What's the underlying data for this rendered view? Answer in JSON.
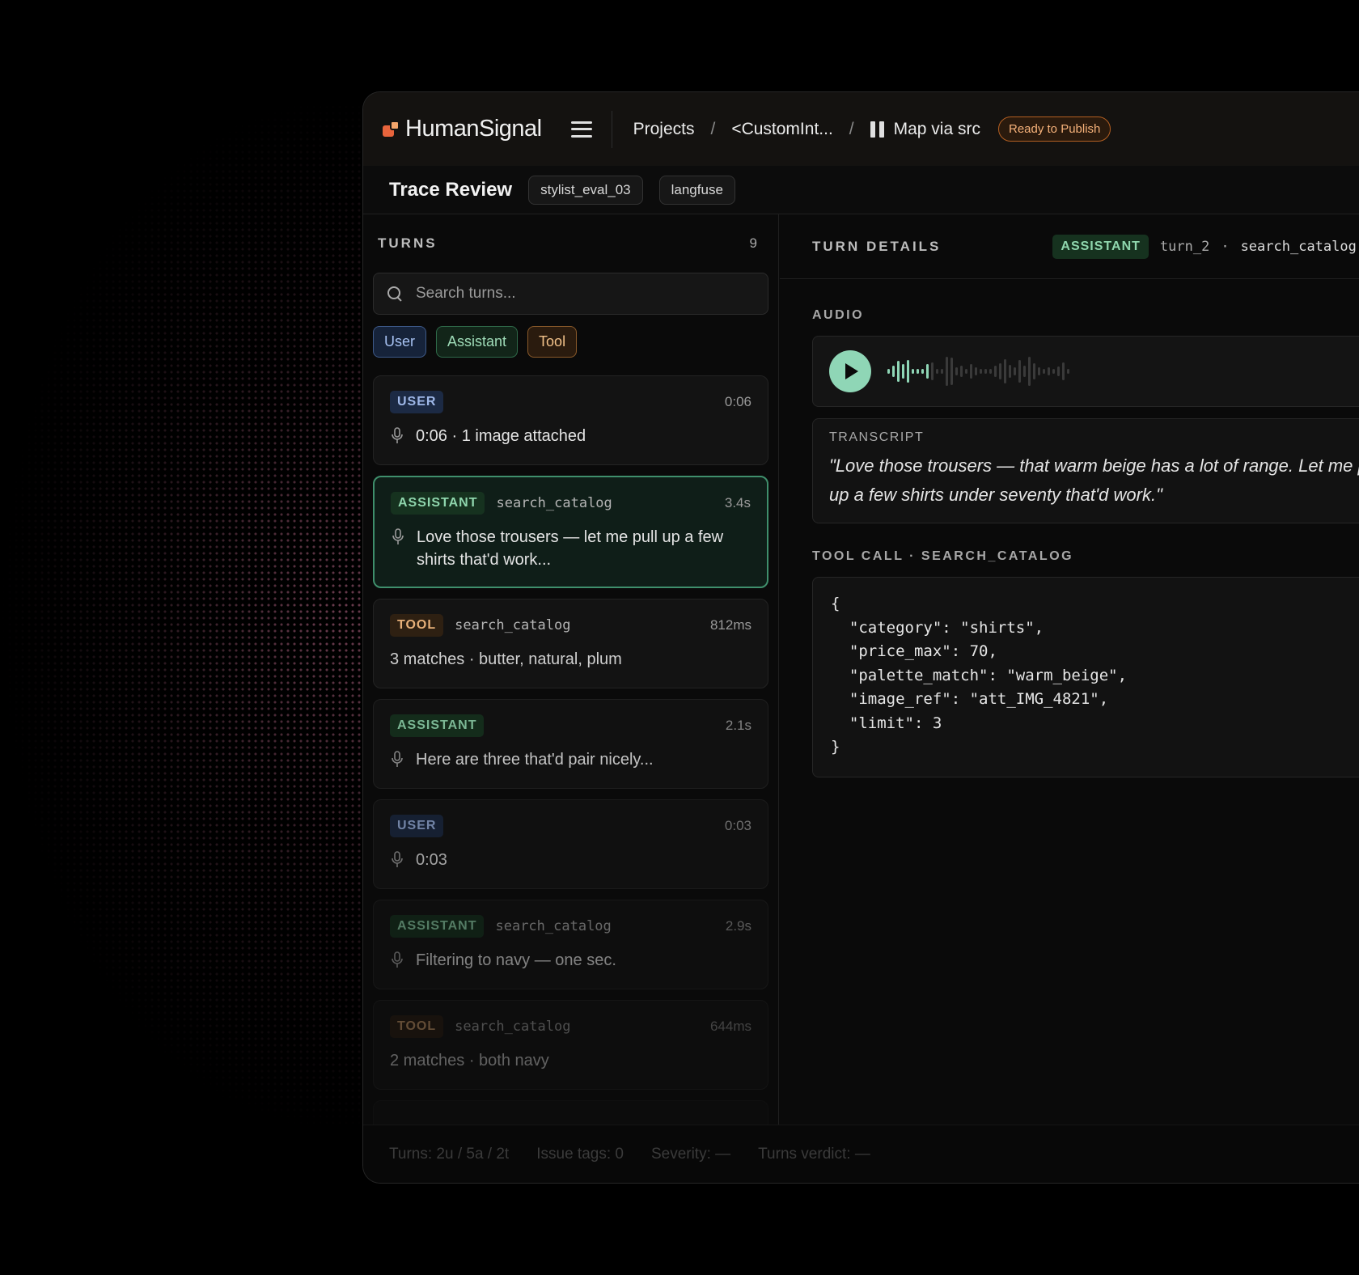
{
  "header": {
    "brand": "HumanSignal",
    "breadcrumbs": [
      "Projects",
      "<CustomInt...",
      "Map via src"
    ],
    "status_badge": "Ready to Publish",
    "page_title": "Trace Review",
    "chips": [
      "stylist_eval_03",
      "langfuse"
    ]
  },
  "turns_panel": {
    "title": "TURNS",
    "count": "9",
    "search_placeholder": "Search turns...",
    "filters": [
      "User",
      "Assistant",
      "Tool"
    ],
    "items": [
      {
        "role": "USER",
        "tool": "",
        "time": "0:06",
        "text": "0:06 · 1 image attached",
        "icon": "mic-icon"
      },
      {
        "role": "ASSISTANT",
        "tool": "search_catalog",
        "time": "3.4s",
        "text": "Love those trousers — let me pull up a few shirts that'd work...",
        "icon": "mic-icon"
      },
      {
        "role": "TOOL",
        "tool": "search_catalog",
        "time": "812ms",
        "text": "3 matches · butter, natural, plum",
        "icon": ""
      },
      {
        "role": "ASSISTANT",
        "tool": "",
        "time": "2.1s",
        "text": "Here are three that'd pair nicely...",
        "icon": "mic-icon"
      },
      {
        "role": "USER",
        "tool": "",
        "time": "0:03",
        "text": "0:03",
        "icon": "mic-icon"
      },
      {
        "role": "ASSISTANT",
        "tool": "search_catalog",
        "time": "2.9s",
        "text": "Filtering to navy — one sec.",
        "icon": "mic-icon"
      },
      {
        "role": "TOOL",
        "tool": "search_catalog",
        "time": "644ms",
        "text": "2 matches · both navy",
        "icon": ""
      }
    ]
  },
  "details": {
    "title": "TURN DETAILS",
    "role_tag": "ASSISTANT",
    "turn_id": "turn_2",
    "separator": "·",
    "tool": "search_catalog",
    "audio_label": "AUDIO",
    "transcript_label": "TRANSCRIPT",
    "transcript": "\"Love those trousers — that warm beige has a lot of range. Let me pull up a few shirts under seventy that'd work.\"",
    "tool_call_label": "TOOL CALL · SEARCH_CATALOG",
    "tool_call_json": "{\n  \"category\": \"shirts\",\n  \"price_max\": 70,\n  \"palette_match\": \"warm_beige\",\n  \"image_ref\": \"att_IMG_4821\",\n  \"limit\": 3\n}"
  },
  "footer": {
    "turns": "Turns: 2u / 5a / 2t",
    "issue_tags": "Issue tags: 0",
    "severity": "Severity: —",
    "verdict": "Turns verdict: —"
  },
  "colors": {
    "accent_green": "#8fd6b6",
    "user_blue": "#9fb8e8",
    "tool_orange": "#e7b079",
    "publish_orange": "#f6b27a"
  }
}
